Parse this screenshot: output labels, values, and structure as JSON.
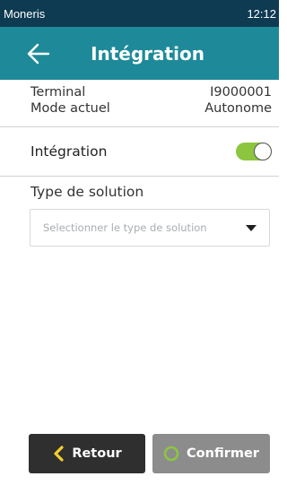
{
  "status_bar": {
    "carrier": "Moneris",
    "time": "12:12"
  },
  "header": {
    "title": "Intégration"
  },
  "info": {
    "terminal_label": "Terminal",
    "terminal_value": "I9000001",
    "mode_label": "Mode actuel",
    "mode_value": "Autonome"
  },
  "integration_toggle": {
    "label": "Intégration",
    "state": "on"
  },
  "solution_type": {
    "label": "Type de solution",
    "placeholder": "Selectionner le type de solution"
  },
  "footer": {
    "back_label": "Retour",
    "confirm_label": "Confirmer"
  },
  "colors": {
    "status_bar": "#0e3a52",
    "header": "#1e8a99",
    "toggle_on": "#8cc63f",
    "back_button": "#2f2f2f",
    "confirm_button": "#8c8c8c",
    "accent_yellow": "#f3d02a",
    "accent_green": "#8cc63f"
  }
}
